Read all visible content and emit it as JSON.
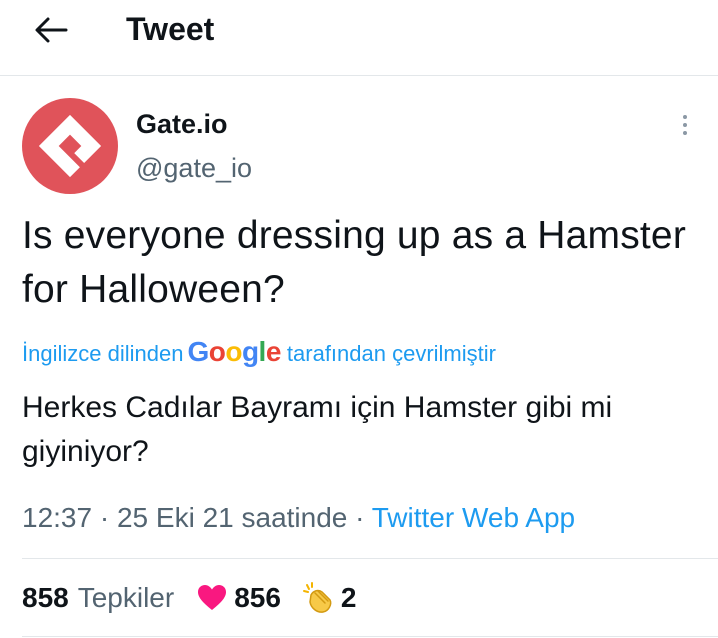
{
  "header": {
    "title": "Tweet",
    "back_icon": "arrow-left-icon"
  },
  "author": {
    "name": "Gate.io",
    "handle": "@gate_io",
    "avatar_color": "#e0535a",
    "avatar_icon": "gate-io-logo"
  },
  "tweet": {
    "text": "Is everyone dressing up as a Hamster for Halloween?",
    "translation": {
      "prefix": "İngilizce dilinden",
      "provider": "Google",
      "suffix": "tarafından çevrilmiştir",
      "text": "Herkes Cadılar Bayramı için Hamster gibi mi giyiniyor?"
    },
    "time": "12:37",
    "date": "25 Eki 21 saatinde",
    "separator": "·",
    "source": "Twitter Web App"
  },
  "stats": {
    "reactions_count": "858",
    "reactions_label": "Tepkiler",
    "heart_count": "856",
    "clap_count": "2"
  },
  "colors": {
    "link": "#1d9bf0",
    "muted": "#536471",
    "heart": "#f91880"
  }
}
